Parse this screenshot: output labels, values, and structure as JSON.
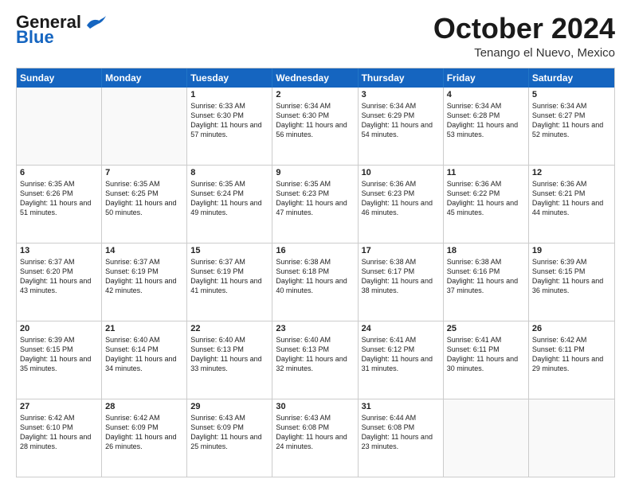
{
  "header": {
    "logo_general": "General",
    "logo_blue": "Blue",
    "month_title": "October 2024",
    "location": "Tenango el Nuevo, Mexico"
  },
  "days_of_week": [
    "Sunday",
    "Monday",
    "Tuesday",
    "Wednesday",
    "Thursday",
    "Friday",
    "Saturday"
  ],
  "weeks": [
    [
      {
        "day": "",
        "sunrise": "",
        "sunset": "",
        "daylight": ""
      },
      {
        "day": "",
        "sunrise": "",
        "sunset": "",
        "daylight": ""
      },
      {
        "day": "1",
        "sunrise": "Sunrise: 6:33 AM",
        "sunset": "Sunset: 6:30 PM",
        "daylight": "Daylight: 11 hours and 57 minutes."
      },
      {
        "day": "2",
        "sunrise": "Sunrise: 6:34 AM",
        "sunset": "Sunset: 6:30 PM",
        "daylight": "Daylight: 11 hours and 56 minutes."
      },
      {
        "day": "3",
        "sunrise": "Sunrise: 6:34 AM",
        "sunset": "Sunset: 6:29 PM",
        "daylight": "Daylight: 11 hours and 54 minutes."
      },
      {
        "day": "4",
        "sunrise": "Sunrise: 6:34 AM",
        "sunset": "Sunset: 6:28 PM",
        "daylight": "Daylight: 11 hours and 53 minutes."
      },
      {
        "day": "5",
        "sunrise": "Sunrise: 6:34 AM",
        "sunset": "Sunset: 6:27 PM",
        "daylight": "Daylight: 11 hours and 52 minutes."
      }
    ],
    [
      {
        "day": "6",
        "sunrise": "Sunrise: 6:35 AM",
        "sunset": "Sunset: 6:26 PM",
        "daylight": "Daylight: 11 hours and 51 minutes."
      },
      {
        "day": "7",
        "sunrise": "Sunrise: 6:35 AM",
        "sunset": "Sunset: 6:25 PM",
        "daylight": "Daylight: 11 hours and 50 minutes."
      },
      {
        "day": "8",
        "sunrise": "Sunrise: 6:35 AM",
        "sunset": "Sunset: 6:24 PM",
        "daylight": "Daylight: 11 hours and 49 minutes."
      },
      {
        "day": "9",
        "sunrise": "Sunrise: 6:35 AM",
        "sunset": "Sunset: 6:23 PM",
        "daylight": "Daylight: 11 hours and 47 minutes."
      },
      {
        "day": "10",
        "sunrise": "Sunrise: 6:36 AM",
        "sunset": "Sunset: 6:23 PM",
        "daylight": "Daylight: 11 hours and 46 minutes."
      },
      {
        "day": "11",
        "sunrise": "Sunrise: 6:36 AM",
        "sunset": "Sunset: 6:22 PM",
        "daylight": "Daylight: 11 hours and 45 minutes."
      },
      {
        "day": "12",
        "sunrise": "Sunrise: 6:36 AM",
        "sunset": "Sunset: 6:21 PM",
        "daylight": "Daylight: 11 hours and 44 minutes."
      }
    ],
    [
      {
        "day": "13",
        "sunrise": "Sunrise: 6:37 AM",
        "sunset": "Sunset: 6:20 PM",
        "daylight": "Daylight: 11 hours and 43 minutes."
      },
      {
        "day": "14",
        "sunrise": "Sunrise: 6:37 AM",
        "sunset": "Sunset: 6:19 PM",
        "daylight": "Daylight: 11 hours and 42 minutes."
      },
      {
        "day": "15",
        "sunrise": "Sunrise: 6:37 AM",
        "sunset": "Sunset: 6:19 PM",
        "daylight": "Daylight: 11 hours and 41 minutes."
      },
      {
        "day": "16",
        "sunrise": "Sunrise: 6:38 AM",
        "sunset": "Sunset: 6:18 PM",
        "daylight": "Daylight: 11 hours and 40 minutes."
      },
      {
        "day": "17",
        "sunrise": "Sunrise: 6:38 AM",
        "sunset": "Sunset: 6:17 PM",
        "daylight": "Daylight: 11 hours and 38 minutes."
      },
      {
        "day": "18",
        "sunrise": "Sunrise: 6:38 AM",
        "sunset": "Sunset: 6:16 PM",
        "daylight": "Daylight: 11 hours and 37 minutes."
      },
      {
        "day": "19",
        "sunrise": "Sunrise: 6:39 AM",
        "sunset": "Sunset: 6:15 PM",
        "daylight": "Daylight: 11 hours and 36 minutes."
      }
    ],
    [
      {
        "day": "20",
        "sunrise": "Sunrise: 6:39 AM",
        "sunset": "Sunset: 6:15 PM",
        "daylight": "Daylight: 11 hours and 35 minutes."
      },
      {
        "day": "21",
        "sunrise": "Sunrise: 6:40 AM",
        "sunset": "Sunset: 6:14 PM",
        "daylight": "Daylight: 11 hours and 34 minutes."
      },
      {
        "day": "22",
        "sunrise": "Sunrise: 6:40 AM",
        "sunset": "Sunset: 6:13 PM",
        "daylight": "Daylight: 11 hours and 33 minutes."
      },
      {
        "day": "23",
        "sunrise": "Sunrise: 6:40 AM",
        "sunset": "Sunset: 6:13 PM",
        "daylight": "Daylight: 11 hours and 32 minutes."
      },
      {
        "day": "24",
        "sunrise": "Sunrise: 6:41 AM",
        "sunset": "Sunset: 6:12 PM",
        "daylight": "Daylight: 11 hours and 31 minutes."
      },
      {
        "day": "25",
        "sunrise": "Sunrise: 6:41 AM",
        "sunset": "Sunset: 6:11 PM",
        "daylight": "Daylight: 11 hours and 30 minutes."
      },
      {
        "day": "26",
        "sunrise": "Sunrise: 6:42 AM",
        "sunset": "Sunset: 6:11 PM",
        "daylight": "Daylight: 11 hours and 29 minutes."
      }
    ],
    [
      {
        "day": "27",
        "sunrise": "Sunrise: 6:42 AM",
        "sunset": "Sunset: 6:10 PM",
        "daylight": "Daylight: 11 hours and 28 minutes."
      },
      {
        "day": "28",
        "sunrise": "Sunrise: 6:42 AM",
        "sunset": "Sunset: 6:09 PM",
        "daylight": "Daylight: 11 hours and 26 minutes."
      },
      {
        "day": "29",
        "sunrise": "Sunrise: 6:43 AM",
        "sunset": "Sunset: 6:09 PM",
        "daylight": "Daylight: 11 hours and 25 minutes."
      },
      {
        "day": "30",
        "sunrise": "Sunrise: 6:43 AM",
        "sunset": "Sunset: 6:08 PM",
        "daylight": "Daylight: 11 hours and 24 minutes."
      },
      {
        "day": "31",
        "sunrise": "Sunrise: 6:44 AM",
        "sunset": "Sunset: 6:08 PM",
        "daylight": "Daylight: 11 hours and 23 minutes."
      },
      {
        "day": "",
        "sunrise": "",
        "sunset": "",
        "daylight": ""
      },
      {
        "day": "",
        "sunrise": "",
        "sunset": "",
        "daylight": ""
      }
    ]
  ]
}
